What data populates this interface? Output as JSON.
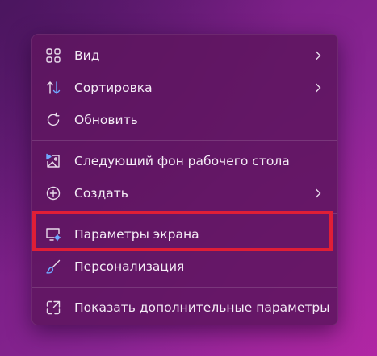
{
  "context_menu": {
    "items": [
      {
        "label": "Вид",
        "icon": "grid-icon",
        "submenu": true
      },
      {
        "label": "Сортировка",
        "icon": "sort-arrows-icon",
        "submenu": true
      },
      {
        "label": "Обновить",
        "icon": "refresh-icon",
        "submenu": false
      },
      {
        "label": "Следующий фон рабочего стола",
        "icon": "next-wallpaper-icon",
        "submenu": false
      },
      {
        "label": "Создать",
        "icon": "plus-circle-icon",
        "submenu": true
      },
      {
        "label": "Параметры экрана",
        "icon": "display-settings-icon",
        "submenu": false
      },
      {
        "label": "Персонализация",
        "icon": "brush-icon",
        "submenu": false
      },
      {
        "label": "Показать дополнительные параметры",
        "icon": "more-options-icon",
        "submenu": false
      }
    ],
    "highlighted_item": "Параметры экрана"
  },
  "colors": {
    "menu_background": "#5e1660",
    "text": "#f4ecf6",
    "highlight_border": "#e01e36",
    "icon_accent": "#6fa8ff"
  }
}
